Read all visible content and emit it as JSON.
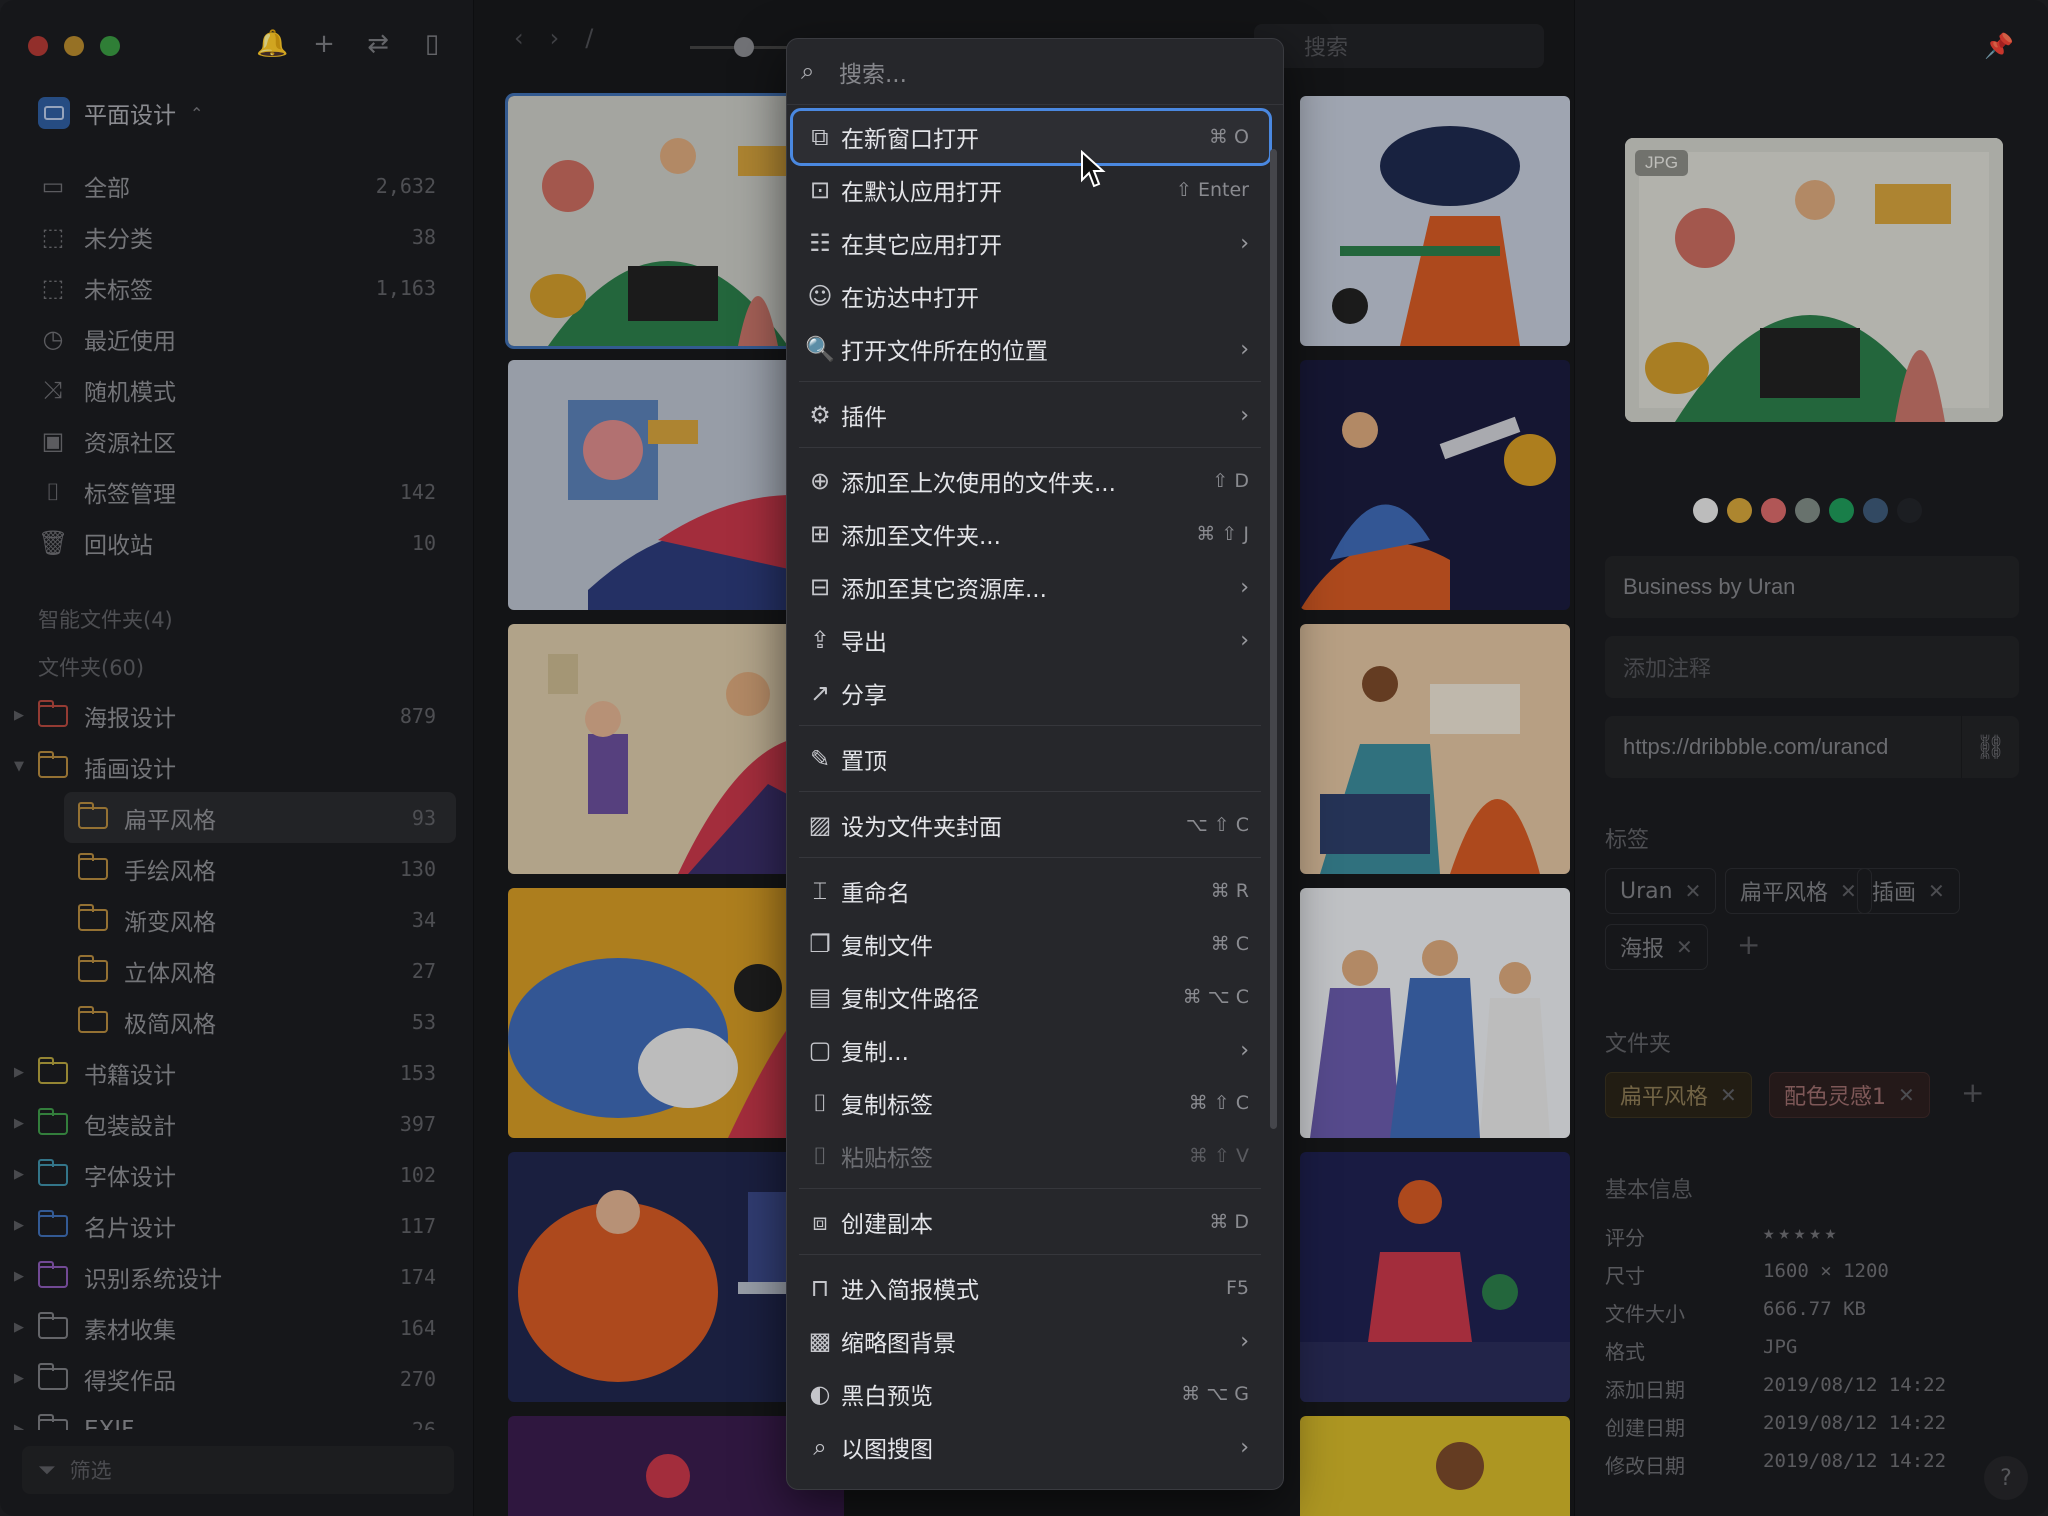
{
  "sidebar": {
    "library": "平面设计",
    "nav": [
      {
        "label": "全部",
        "count": "2,632",
        "icon": "inbox-icon",
        "glyph": "▭"
      },
      {
        "label": "未分类",
        "count": "38",
        "icon": "unsorted-icon",
        "glyph": "⬚"
      },
      {
        "label": "未标签",
        "count": "1,163",
        "icon": "untagged-icon",
        "glyph": "⬚"
      },
      {
        "label": "最近使用",
        "count": "",
        "icon": "clock-icon",
        "glyph": "◷"
      },
      {
        "label": "随机模式",
        "count": "",
        "icon": "shuffle-icon",
        "glyph": "⤨"
      },
      {
        "label": "资源社区",
        "count": "",
        "icon": "community-icon",
        "glyph": "▣"
      },
      {
        "label": "标签管理",
        "count": "142",
        "icon": "bookmark-icon",
        "glyph": "⌷"
      },
      {
        "label": "回收站",
        "count": "10",
        "icon": "trash-icon",
        "glyph": "🗑"
      }
    ],
    "smart_folders": "智能文件夹(4)",
    "folders_title": "文件夹(60)",
    "folders": [
      {
        "label": "海报设计",
        "count": "879",
        "color": "#b5483f",
        "expanded": false,
        "sub": false
      },
      {
        "label": "插画设计",
        "count": "",
        "color": "#b58a3f",
        "expanded": true,
        "sub": false
      },
      {
        "label": "扁平风格",
        "count": "93",
        "color": "#b58a3f",
        "sub": true,
        "selected": true
      },
      {
        "label": "手绘风格",
        "count": "130",
        "color": "#b58a3f",
        "sub": true
      },
      {
        "label": "渐变风格",
        "count": "34",
        "color": "#b58a3f",
        "sub": true
      },
      {
        "label": "立体风格",
        "count": "27",
        "color": "#b58a3f",
        "sub": true
      },
      {
        "label": "极简风格",
        "count": "53",
        "color": "#b58a3f",
        "sub": true
      },
      {
        "label": "书籍设计",
        "count": "153",
        "color": "#b5a33f",
        "expanded": false,
        "sub": false
      },
      {
        "label": "包装設計",
        "count": "397",
        "color": "#3f9a4a",
        "expanded": false,
        "sub": false
      },
      {
        "label": "字体设计",
        "count": "102",
        "color": "#3f8fa8",
        "expanded": false,
        "sub": false
      },
      {
        "label": "名片设计",
        "count": "117",
        "color": "#3f6eb5",
        "expanded": false,
        "sub": false
      },
      {
        "label": "识别系统设计",
        "count": "174",
        "color": "#8a5ab5",
        "expanded": false,
        "sub": false
      },
      {
        "label": "素材收集",
        "count": "164",
        "color": "#7b7c81",
        "expanded": false,
        "sub": false
      },
      {
        "label": "得奖作品",
        "count": "270",
        "color": "#7b7c81",
        "expanded": false,
        "sub": false
      },
      {
        "label": "EXIF",
        "count": "26",
        "color": "#7b7c81",
        "expanded": false,
        "sub": false
      }
    ],
    "filter_label": "筛选"
  },
  "main": {
    "search_placeholder": "搜索"
  },
  "menu": {
    "search_placeholder": "搜索...",
    "items": [
      {
        "label": "在新窗口打开",
        "shortcut": "⌘ O",
        "icon": "new-window-icon",
        "glyph": "⧉",
        "highlight": true
      },
      {
        "label": "在默认应用打开",
        "shortcut": "⇧ Enter",
        "icon": "default-app-icon",
        "glyph": "⊡"
      },
      {
        "label": "在其它应用打开",
        "submenu": true,
        "icon": "other-apps-icon",
        "glyph": "☷"
      },
      {
        "label": "在访达中打开",
        "icon": "finder-icon",
        "glyph": "☺"
      },
      {
        "label": "打开文件所在的位置",
        "submenu": true,
        "icon": "file-location-icon",
        "glyph": "🔍"
      },
      {
        "sep": true
      },
      {
        "label": "插件",
        "submenu": true,
        "icon": "plugin-icon",
        "glyph": "⚙"
      },
      {
        "sep": true
      },
      {
        "label": "添加至上次使用的文件夹...",
        "shortcut": "⇧ D",
        "icon": "recent-folder-icon",
        "glyph": "⊕"
      },
      {
        "label": "添加至文件夹...",
        "shortcut": "⌘ ⇧ J",
        "icon": "add-folder-icon",
        "glyph": "⊞"
      },
      {
        "label": "添加至其它资源库...",
        "submenu": true,
        "icon": "other-library-icon",
        "glyph": "⊟"
      },
      {
        "label": "导出",
        "submenu": true,
        "icon": "export-icon",
        "glyph": "⇪"
      },
      {
        "label": "分享",
        "icon": "share-icon",
        "glyph": "↗"
      },
      {
        "sep": true
      },
      {
        "label": "置顶",
        "icon": "pin-icon",
        "glyph": "✎"
      },
      {
        "sep": true
      },
      {
        "label": "设为文件夹封面",
        "shortcut": "⌥ ⇧ C",
        "icon": "folder-cover-icon",
        "glyph": "▨"
      },
      {
        "sep": true
      },
      {
        "label": "重命名",
        "shortcut": "⌘ R",
        "icon": "rename-icon",
        "glyph": "⌶"
      },
      {
        "label": "复制文件",
        "shortcut": "⌘ C",
        "icon": "copy-file-icon",
        "glyph": "❐"
      },
      {
        "label": "复制文件路径",
        "shortcut": "⌘ ⌥ C",
        "icon": "copy-path-icon",
        "glyph": "▤"
      },
      {
        "label": "复制...",
        "submenu": true,
        "icon": "copy-icon",
        "glyph": "▢"
      },
      {
        "label": "复制标签",
        "shortcut": "⌘ ⇧ C",
        "icon": "copy-tags-icon",
        "glyph": "⌷"
      },
      {
        "label": "粘贴标签",
        "shortcut": "⌘ ⇧ V",
        "icon": "paste-tags-icon",
        "glyph": "⌷",
        "disabled": true
      },
      {
        "sep": true
      },
      {
        "label": "创建副本",
        "shortcut": "⌘ D",
        "icon": "duplicate-icon",
        "glyph": "⧈"
      },
      {
        "sep": true
      },
      {
        "label": "进入简报模式",
        "shortcut": "F5",
        "icon": "presentation-icon",
        "glyph": "⊓"
      },
      {
        "label": "缩略图背景",
        "submenu": true,
        "icon": "thumbnail-bg-icon",
        "glyph": "▩"
      },
      {
        "label": "黑白预览",
        "shortcut": "⌘ ⌥ G",
        "icon": "grayscale-icon",
        "glyph": "◐"
      },
      {
        "label": "以图搜图",
        "submenu": true,
        "icon": "image-search-icon",
        "glyph": "⌕"
      }
    ]
  },
  "right": {
    "badge": "JPG",
    "palette": [
      "#e6e6e6",
      "#d4a43a",
      "#d86a6a",
      "#7f8c86",
      "#1f9a5a",
      "#3e5a78",
      "#23252a"
    ],
    "title": "Business by Uran",
    "note_placeholder": "添加注释",
    "url": "https://dribbble.com/urancd",
    "tags_title": "标签",
    "tags": [
      "Uran",
      "扁平风格",
      "插画",
      "海报"
    ],
    "folders_title": "文件夹",
    "folders": [
      "扁平风格",
      "配色灵感1"
    ],
    "info_title": "基本信息",
    "info": [
      {
        "k": "评分",
        "v": "★★★★★",
        "stars": true
      },
      {
        "k": "尺寸",
        "v": "1600 × 1200"
      },
      {
        "k": "文件大小",
        "v": "666.77 KB"
      },
      {
        "k": "格式",
        "v": "JPG"
      },
      {
        "k": "添加日期",
        "v": "2019/08/12 14:22"
      },
      {
        "k": "创建日期",
        "v": "2019/08/12 14:22"
      },
      {
        "k": "修改日期",
        "v": "2019/08/12 14:22"
      }
    ],
    "help": "?"
  }
}
